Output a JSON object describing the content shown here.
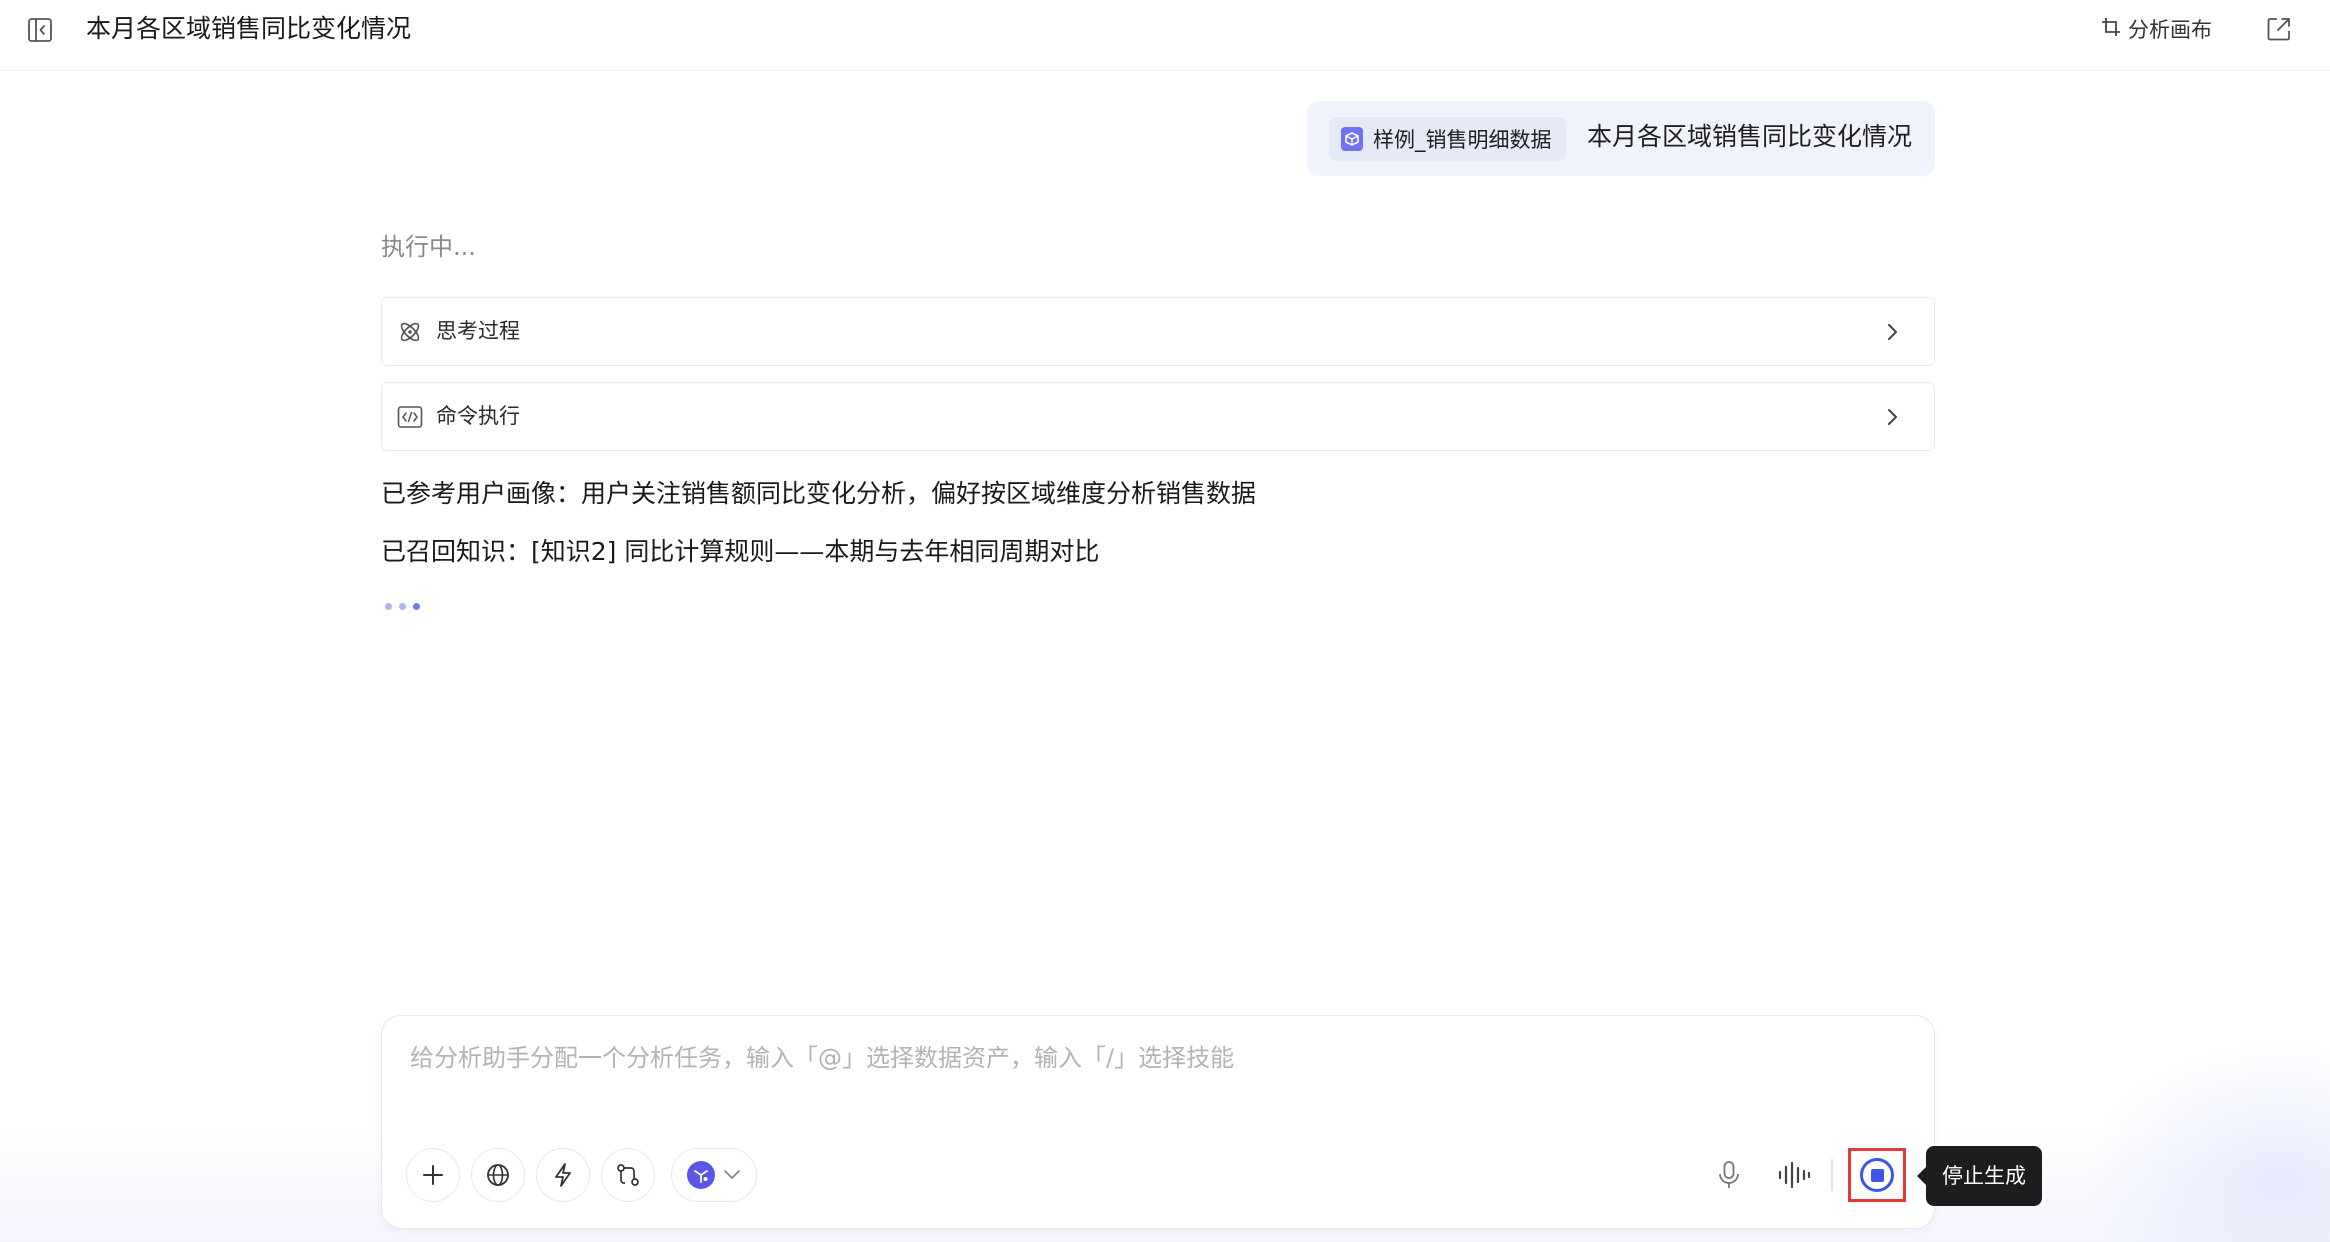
{
  "header": {
    "title": "本月各区域销售同比变化情况",
    "canvas_label": "分析画布",
    "sidebar_toggle_icon": "sidebar-collapse-icon",
    "canvas_icon": "crop-icon",
    "share_icon": "external-link-icon"
  },
  "user_message": {
    "dataset_name": "样例_销售明细数据",
    "dataset_icon": "dataset-box-icon",
    "text": "本月各区域销售同比变化情况"
  },
  "response": {
    "status": "执行中...",
    "panels": [
      {
        "label": "思考过程",
        "icon": "atom-icon"
      },
      {
        "label": "命令执行",
        "icon": "code-icon"
      }
    ],
    "lines": [
      "已参考用户画像：用户关注销售额同比变化分析，偏好按区域维度分析销售数据",
      "已召回知识：[知识2] 同比计算规则——本期与去年相同周期对比"
    ]
  },
  "composer": {
    "placeholder": "给分析助手分配一个分析任务，输入「@」选择数据资产，输入「/」选择技能",
    "value": "",
    "tools": [
      "plus-icon",
      "globe-icon",
      "lightning-icon",
      "workflow-icon"
    ],
    "model_icon": "model-logo-icon",
    "mic_icon": "microphone-icon",
    "voice_icon": "voice-wave-icon",
    "stop_icon": "stop-icon"
  },
  "tooltip": {
    "text": "停止生成"
  },
  "colors": {
    "accent": "#3c55e8",
    "dataset_icon": "#6f72f2",
    "bubble_bg": "#f1f3fc",
    "highlight": "#e53935",
    "tooltip_bg": "#1d1d1f"
  }
}
